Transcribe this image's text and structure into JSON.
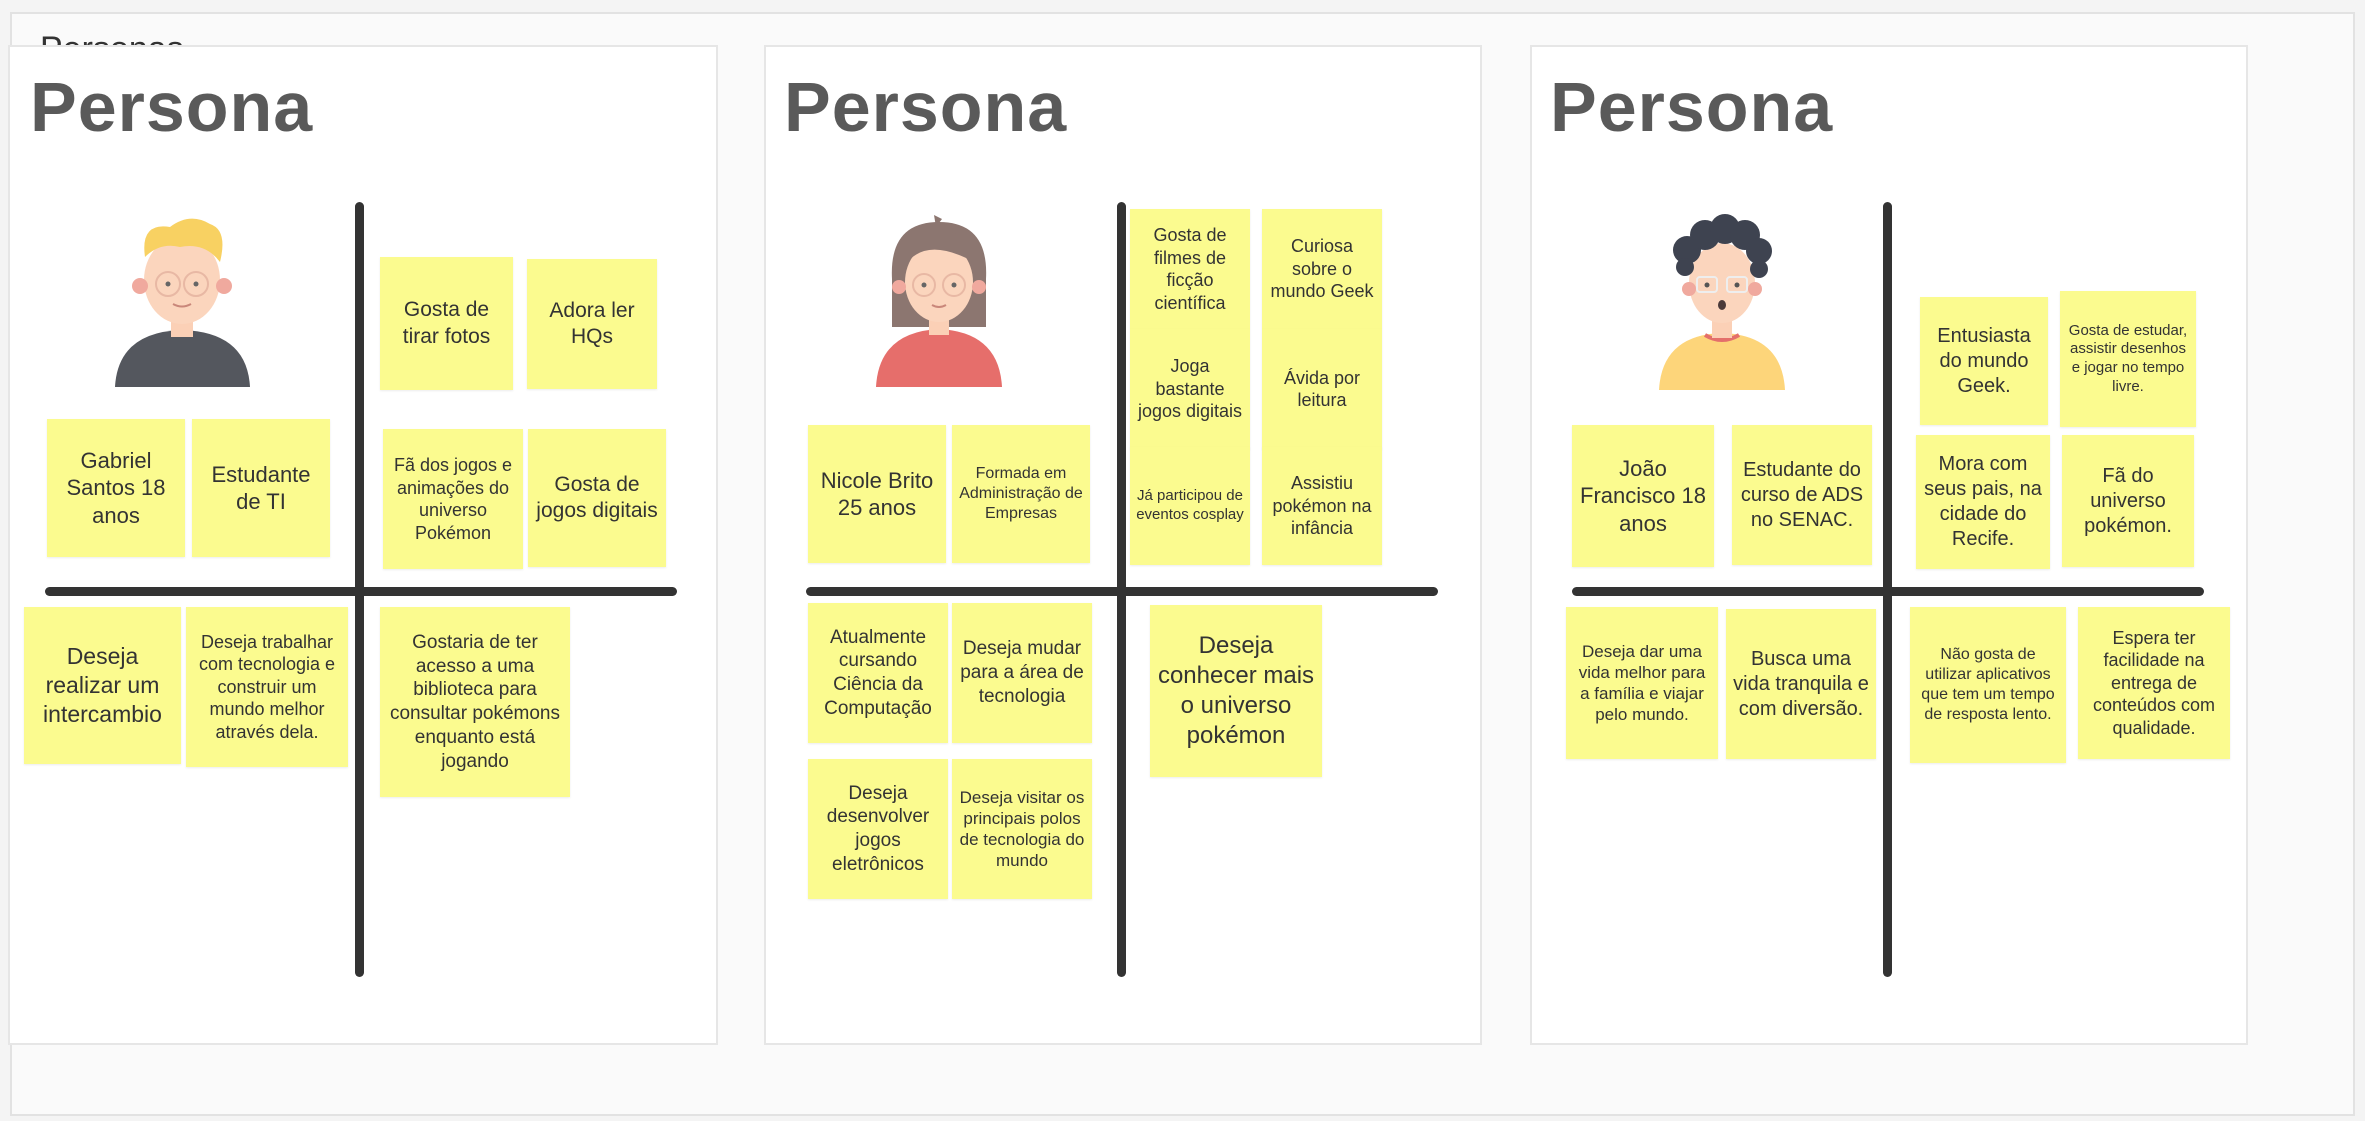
{
  "frame": {
    "title": "Personas"
  },
  "boards": [
    {
      "title": "Persona",
      "notes": {
        "name": "Gabriel Santos 18 anos",
        "role": "Estudante de TI",
        "n1": "Gosta de tirar fotos",
        "n2": "Adora ler HQs",
        "n3": "Fã dos jogos e animações do universo Pokémon",
        "n4": "Gosta de jogos digitais",
        "n5": "Deseja realizar um intercambio",
        "n6": "Deseja trabalhar com tecnologia e construir um mundo melhor através dela.",
        "n7": "Gostaria de ter acesso a uma biblioteca para consultar pokémons enquanto  está jogando"
      }
    },
    {
      "title": "Persona",
      "notes": {
        "name": "Nicole Brito 25 anos",
        "role": "Formada em Administração de Empresas",
        "n1": "Gosta de filmes de ficção científica",
        "n2": "Curiosa sobre o mundo Geek",
        "n3": "Joga bastante jogos digitais",
        "n4": "Ávida por leitura",
        "n5": "Já participou de eventos cosplay",
        "n6": "Assistiu pokémon na infância",
        "n7": "Atualmente cursando Ciência da Computação",
        "n8": "Deseja mudar para a área de tecnologia",
        "n9": "Deseja desenvolver jogos eletrônicos",
        "n10": "Deseja visitar os principais polos de tecnologia do mundo",
        "n11": "Deseja conhecer mais o universo pokémon"
      }
    },
    {
      "title": "Persona",
      "notes": {
        "name": "João Francisco 18 anos",
        "role": "Estudante do curso de ADS no SENAC.",
        "n1": "Entusiasta do mundo Geek.",
        "n2": "Gosta de estudar, assistir desenhos e jogar no tempo livre.",
        "n3": "Mora com seus pais, na cidade do Recife.",
        "n4": "Fã do universo pokémon.",
        "n5": "Deseja dar uma vida melhor para a família e viajar pelo mundo.",
        "n6": "Busca uma vida tranquila e com diversão.",
        "n7": "Não gosta de utilizar aplicativos que tem um tempo de resposta lento.",
        "n8": "Espera ter facilidade na entrega de conteúdos com qualidade."
      }
    }
  ],
  "colors": {
    "note": "#fbfb8f",
    "axis": "#333333",
    "board": "#ffffff"
  },
  "icons": [
    "avatar-blond-boy-icon",
    "avatar-brown-hair-girl-icon",
    "avatar-curly-hair-boy-icon"
  ]
}
